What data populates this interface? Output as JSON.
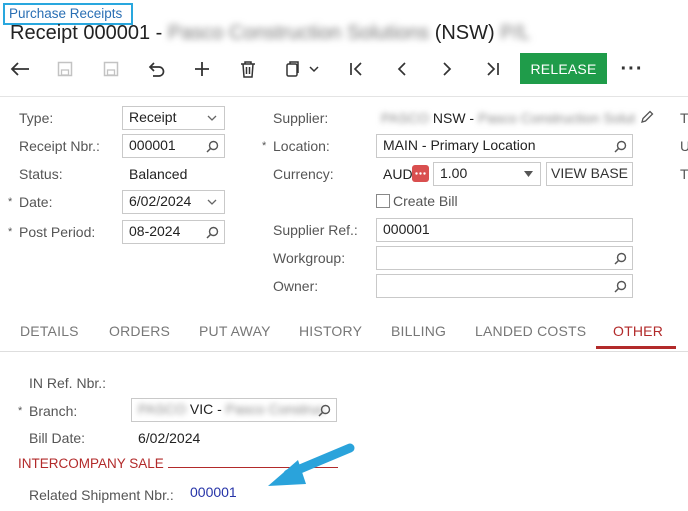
{
  "breadcrumb": "Purchase Receipts",
  "title": {
    "prefix": "Receipt 000001 -",
    "blurred_name": "Pasco Construction Solutions",
    "suffix": "(NSW)",
    "blurred_suffix": "P/L"
  },
  "toolbar": {
    "release_label": "RELEASE",
    "more_label": "···"
  },
  "form": {
    "type": {
      "label": "Type:",
      "value": "Receipt"
    },
    "receipt_nbr": {
      "label": "Receipt Nbr.:",
      "value": "000001"
    },
    "status": {
      "label": "Status:",
      "value": "Balanced"
    },
    "date": {
      "label": "Date:",
      "value": "6/02/2024"
    },
    "post_period": {
      "label": "Post Period:",
      "value": "08-2024"
    },
    "supplier": {
      "label": "Supplier:",
      "blurred_code": "PASCO",
      "value": "NSW -",
      "blurred_name": "Pasco Construction Solut"
    },
    "location": {
      "label": "Location:",
      "value": "MAIN - Primary Location"
    },
    "currency": {
      "label": "Currency:",
      "value": "AUD",
      "rate": "1.00",
      "view_base": "VIEW BASE"
    },
    "create_bill": {
      "label": "Create Bill"
    },
    "supplier_ref": {
      "label": "Supplier Ref.:",
      "value": "000001"
    },
    "workgroup": {
      "label": "Workgroup:",
      "value": ""
    },
    "owner": {
      "label": "Owner:",
      "value": ""
    },
    "right_edge_labels": [
      "T",
      "U",
      "T"
    ]
  },
  "tabs": [
    "DETAILS",
    "ORDERS",
    "PUT AWAY",
    "HISTORY",
    "BILLING",
    "LANDED COSTS",
    "OTHER"
  ],
  "other": {
    "in_ref": {
      "label": "IN Ref. Nbr.:",
      "value": ""
    },
    "branch": {
      "label": "Branch:",
      "blurred_code": "PASCO",
      "value": "VIC -",
      "blurred_name": "Pasco Construc"
    },
    "bill_date": {
      "label": "Bill Date:",
      "value": "6/02/2024"
    },
    "section_title": "INTERCOMPANY SALE",
    "related_shipment": {
      "label": "Related Shipment Nbr.:",
      "value": "000001"
    }
  },
  "colors": {
    "accent_red": "#b22a2a",
    "release_green": "#1f9c4a",
    "breadcrumb_border": "#29a7de",
    "arrow_blue": "#2aa3db",
    "link_blue": "#2634a8"
  }
}
